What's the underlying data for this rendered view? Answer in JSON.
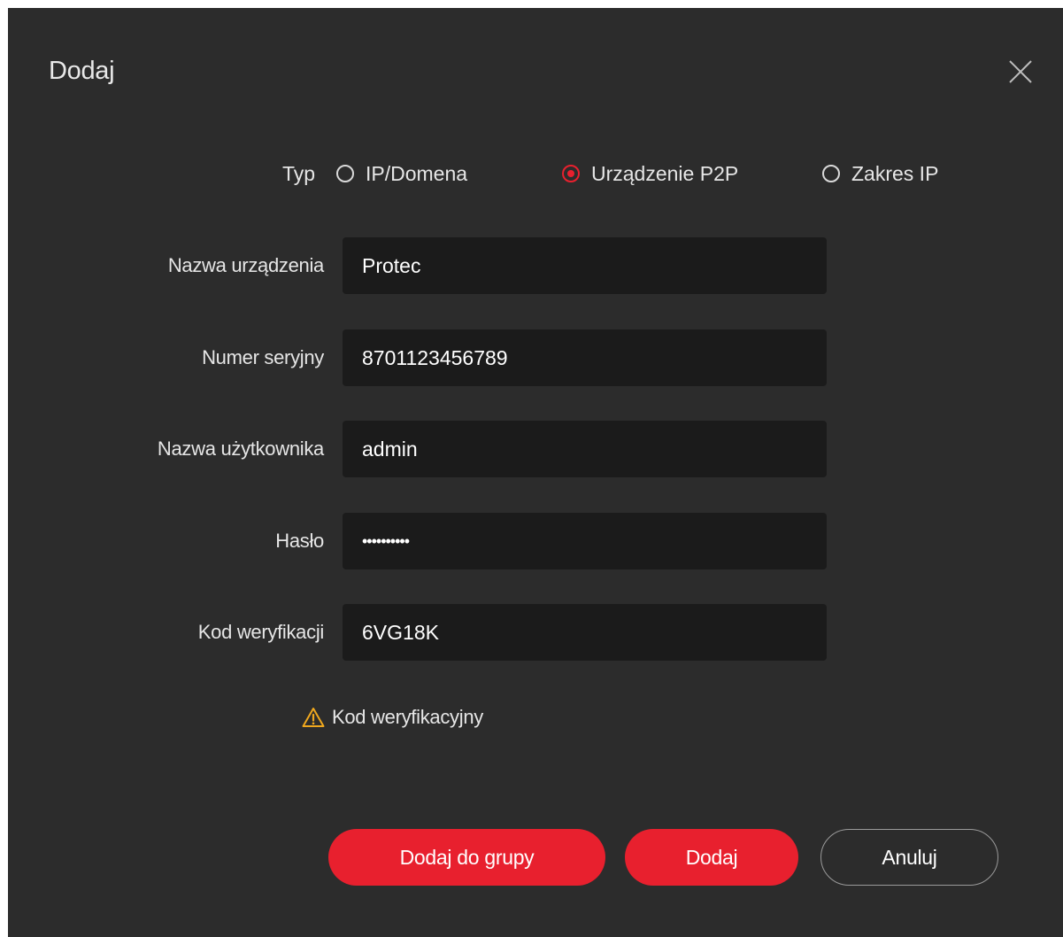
{
  "dialog": {
    "title": "Dodaj",
    "close_icon": "close-icon"
  },
  "type_selector": {
    "label": "Typ",
    "options": [
      {
        "label": "IP/Domena",
        "selected": false
      },
      {
        "label": "Urządzenie P2P",
        "selected": true
      },
      {
        "label": "Zakres IP",
        "selected": false
      }
    ]
  },
  "form": {
    "device_name": {
      "label": "Nazwa urządzenia",
      "value": "Protec"
    },
    "serial_number": {
      "label": "Numer seryjny",
      "value": "8701123456789"
    },
    "username": {
      "label": "Nazwa użytkownika",
      "value": "admin"
    },
    "password": {
      "label": "Hasło",
      "value": "••••••••••"
    },
    "verification_code": {
      "label": "Kod weryfikacji",
      "value": "6VG18K"
    }
  },
  "hint": {
    "icon": "warning-icon",
    "text": "Kod weryfikacyjny"
  },
  "buttons": {
    "add_to_group": "Dodaj do grupy",
    "add": "Dodaj",
    "cancel": "Anuluj"
  },
  "colors": {
    "accent": "#e8202e",
    "dialog_bg": "#2c2c2c",
    "field_bg": "#1b1b1b",
    "warning": "#f0a81e"
  }
}
